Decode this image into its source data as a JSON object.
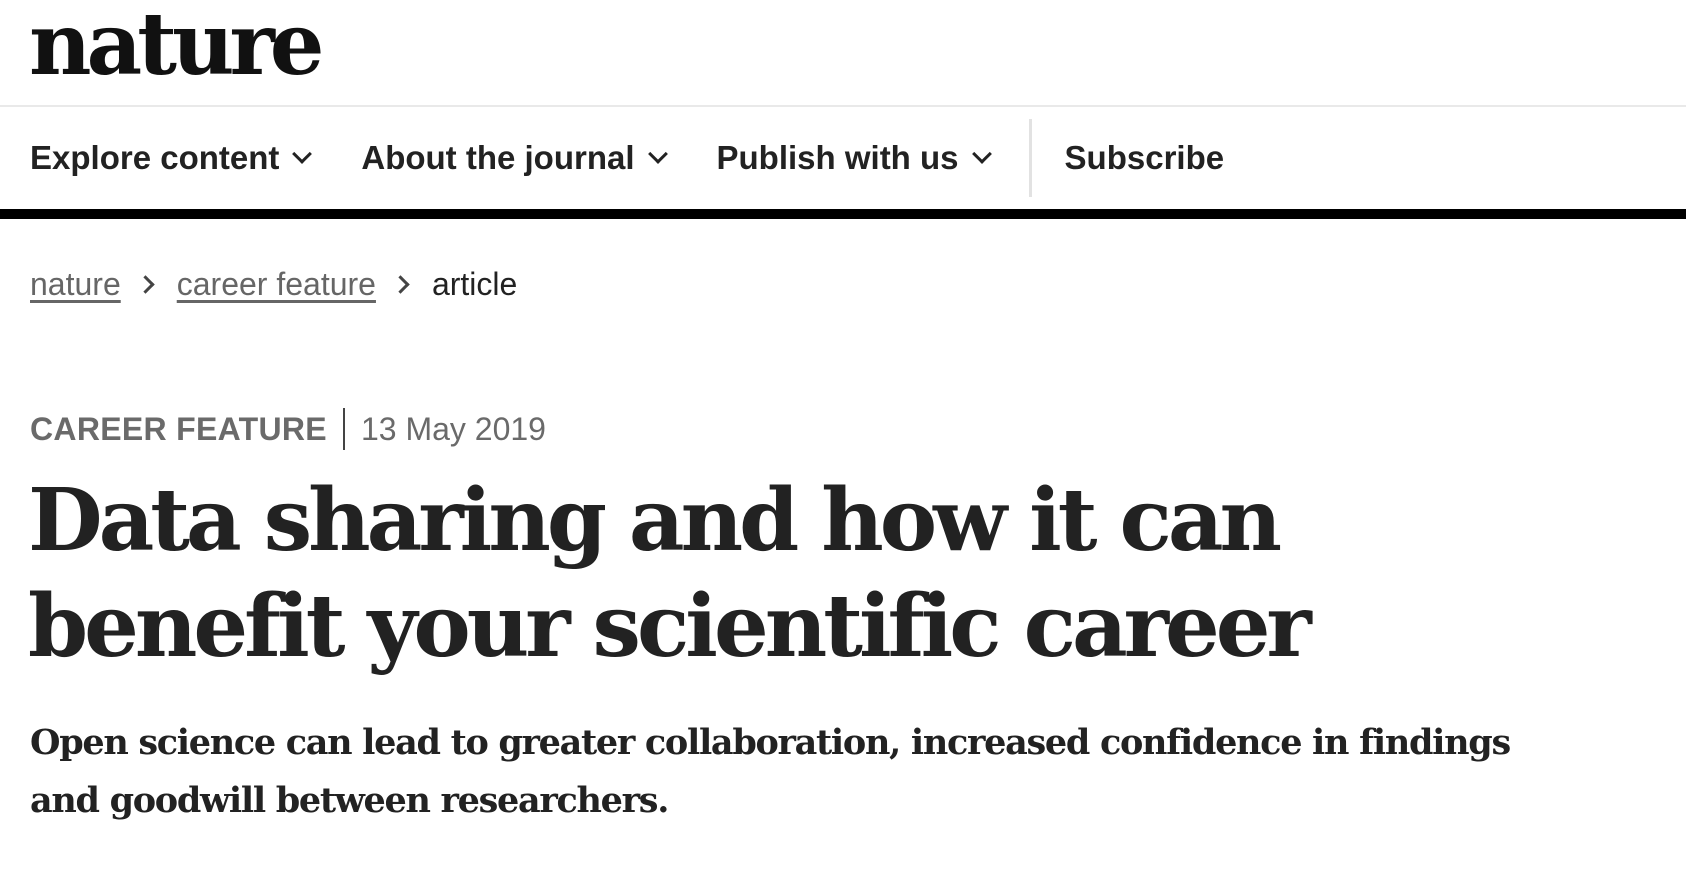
{
  "site": {
    "logo": "nature"
  },
  "nav": {
    "items": [
      {
        "label": "Explore content",
        "icon": "chevron-down-icon"
      },
      {
        "label": "About the journal",
        "icon": "chevron-down-icon"
      },
      {
        "label": "Publish with us",
        "icon": "chevron-down-icon"
      }
    ],
    "subscribe": "Subscribe"
  },
  "breadcrumb": {
    "items": [
      "nature",
      "career feature",
      "article"
    ]
  },
  "article": {
    "type": "CAREER FEATURE",
    "date": "13 May 2019",
    "title": "Data sharing and how it can benefit your scientific career",
    "standfirst": "Open science can lead to greater collaboration, increased confidence in findings and goodwill between researchers."
  },
  "colors": {
    "text": "#222222",
    "muted": "#6a6a6a",
    "nav_rule": "#000000",
    "divider": "#e9e9e9"
  }
}
